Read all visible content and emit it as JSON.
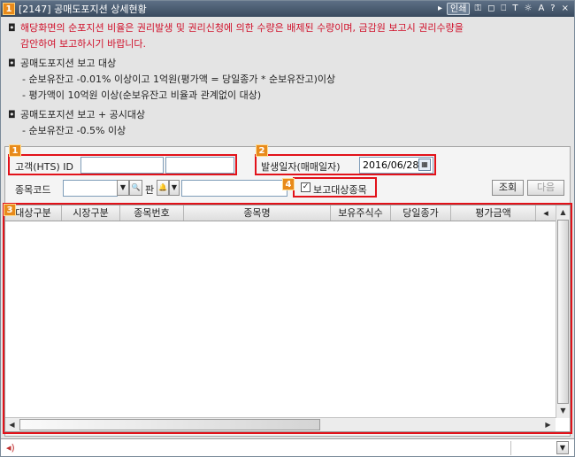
{
  "window": {
    "number_badge": "1",
    "title": "[2147] 공매도포지션 상세현황",
    "tools": [
      "인쇄",
      "⚿",
      "◻",
      "⎕",
      "T",
      "☼",
      "A",
      "?",
      "×"
    ]
  },
  "notice": {
    "warning_line1": "해당화면의 순포지션 비율은 권리발생 및 권리신청에 의한 수량은 배제된 수량이며, 금감원 보고시 권리수량을",
    "warning_line2": "감안하여 보고하시기 바랍니다.",
    "section1_title": "공매도포지션 보고 대상",
    "section1_item1": "- 순보유잔고 -0.01% 이상이고 1억원(평가액 = 당일종가 * 순보유잔고)이상",
    "section1_item2": "- 평가액이 10억원 이상(순보유잔고 비율과 관계없이 대상)",
    "section2_title": "공매도포지션 보고 + 공시대상",
    "section2_item1": "- 순보유잔고 -0.5% 이상",
    "bullet": "◘"
  },
  "form": {
    "tags": [
      "1",
      "2",
      "3",
      "4"
    ],
    "customer_label": "고객(HTS) ID",
    "customer_id_value": "",
    "customer_name_value": "",
    "date_label": "발생일자(매매일자)",
    "date_value": "2016/06/28",
    "stock_label": "종목코드",
    "stock_code_value": "",
    "board_label": "판",
    "stock_name_value": "",
    "report_checkbox_label": "보고대상종목",
    "report_checkbox_checked": true,
    "query_button": "조회",
    "next_button": "다음"
  },
  "grid": {
    "columns": [
      "대상구분",
      "시장구분",
      "종목번호",
      "종목명",
      "보유주식수",
      "당일종가",
      "평가금액"
    ],
    "rows": []
  },
  "colors": {
    "accent_red": "#e2121a",
    "tag_orange": "#e88a1a",
    "warning_text": "#d0102a"
  }
}
